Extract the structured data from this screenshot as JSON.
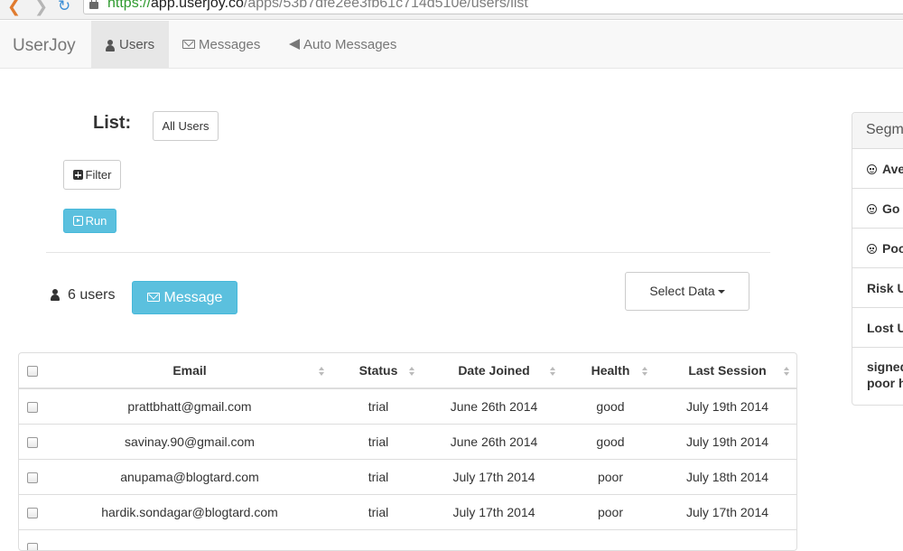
{
  "browser": {
    "url_scheme": "https://",
    "url_host": "app.userjoy.co",
    "url_path": "/apps/53b7dfe2ee3fb61c714d510e/users/list"
  },
  "navbar": {
    "brand": "UserJoy",
    "items": [
      {
        "label": "Users",
        "icon": "user-icon",
        "active": true
      },
      {
        "label": "Messages",
        "icon": "envelope-icon",
        "active": false
      },
      {
        "label": "Auto Messages",
        "icon": "bullhorn-icon",
        "active": false
      }
    ]
  },
  "list": {
    "title": "List:",
    "selected_list": "All Users",
    "filter_label": "Filter",
    "run_label": "Run"
  },
  "summary": {
    "count_text": "6 users",
    "message_button": "Message",
    "select_data_button": "Select Data"
  },
  "table": {
    "columns": [
      "Email",
      "Status",
      "Date Joined",
      "Health",
      "Last Session"
    ],
    "rows": [
      {
        "email": "prattbhatt@gmail.com",
        "status": "trial",
        "date_joined": "June 26th 2014",
        "health": "good",
        "last_session": "July 19th 2014"
      },
      {
        "email": "savinay.90@gmail.com",
        "status": "trial",
        "date_joined": "June 26th 2014",
        "health": "good",
        "last_session": "July 19th 2014"
      },
      {
        "email": "anupama@blogtard.com",
        "status": "trial",
        "date_joined": "July 17th 2014",
        "health": "poor",
        "last_session": "July 18th 2014"
      },
      {
        "email": "hardik.sondagar@blogtard.com",
        "status": "trial",
        "date_joined": "July 17th 2014",
        "health": "poor",
        "last_session": "July 17th 2014"
      },
      {
        "email": "",
        "status": "",
        "date_joined": "",
        "health": "",
        "last_session": ""
      }
    ]
  },
  "segments": {
    "title": "Segm",
    "items": [
      {
        "label": "Ave",
        "icon": "smile-icon"
      },
      {
        "label": "Go",
        "icon": "smile-icon"
      },
      {
        "label": "Poo",
        "icon": "frown-icon"
      },
      {
        "label": "Risk U",
        "icon": ""
      },
      {
        "label": "Lost U",
        "icon": ""
      },
      {
        "label": "signed",
        "label2": "poor h",
        "icon": ""
      }
    ]
  },
  "colors": {
    "info_button": "#5bc0de",
    "navbar_bg": "#f8f8f8",
    "active_nav_bg": "#e7e7e7",
    "url_scheme": "#2e9a2e"
  }
}
